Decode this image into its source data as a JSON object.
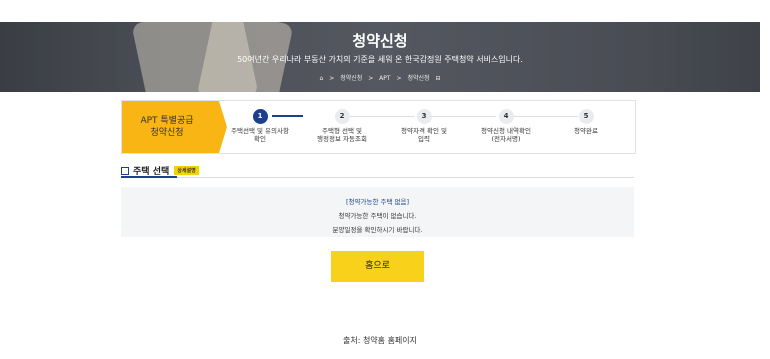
{
  "banner": {
    "title": "청약신청",
    "subtitle": "50여년간 우리나라 부동산 가치의 기준을 세워 온 한국감정원 주택청약 서비스입니다.",
    "breadcrumb": {
      "sep": ">",
      "item1": "청약신청",
      "item2": "APT",
      "item3": "청약신청",
      "home_icon": "home-icon"
    }
  },
  "steps": {
    "header_line1": "APT 특별공급",
    "header_line2": "청약신청",
    "items": [
      {
        "num": "1",
        "line1": "주택선택 및 유의사항",
        "line2": "확인"
      },
      {
        "num": "2",
        "line1": "주택형 선택 및",
        "line2": "행정정보 자동조회"
      },
      {
        "num": "3",
        "line1": "청약자격 확인 및",
        "line2": "입력"
      },
      {
        "num": "4",
        "line1": "청약신청 내역확인",
        "line2": "(전자서명)"
      },
      {
        "num": "5",
        "line1": "청약완료",
        "line2": ""
      }
    ],
    "active_step": 1
  },
  "section": {
    "title": "주택 선택",
    "badge": "상세설명"
  },
  "notice": {
    "heading": "[청약가능한 주택 없음]",
    "line1": "청약가능한 주택이 없습니다.",
    "line2": "분양일정을 확인하시기 바랍니다."
  },
  "home_button": "홈으로",
  "source": "출처: 청약홈 홈페이지",
  "colors": {
    "accent": "#1c3f8f",
    "yellow": "#f8b514",
    "button": "#f8d11a"
  }
}
